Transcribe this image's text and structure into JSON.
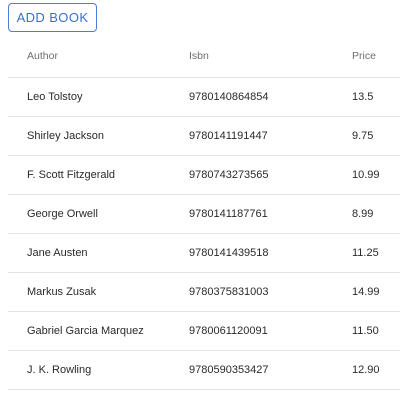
{
  "toolbar": {
    "add_label": "ADD BOOK"
  },
  "table": {
    "headers": [
      "Author",
      "Isbn",
      "Price"
    ],
    "rows": [
      {
        "author": "Leo Tolstoy",
        "isbn": "9780140864854",
        "price": "13.5"
      },
      {
        "author": "Shirley Jackson",
        "isbn": "9780141191447",
        "price": "9.75"
      },
      {
        "author": "F. Scott Fitzgerald",
        "isbn": "9780743273565",
        "price": "10.99"
      },
      {
        "author": "George Orwell",
        "isbn": "9780141187761",
        "price": "8.99"
      },
      {
        "author": "Jane Austen",
        "isbn": "9780141439518",
        "price": "11.25"
      },
      {
        "author": "Markus Zusak",
        "isbn": "9780375831003",
        "price": "14.99"
      },
      {
        "author": "Gabriel Garcia Marquez",
        "isbn": "9780061120091",
        "price": "11.50"
      },
      {
        "author": "J. K. Rowling",
        "isbn": "9780590353427",
        "price": "12.90"
      }
    ]
  },
  "colors": {
    "accent": "#3b71c9",
    "divider": "#e3e3e3",
    "header_text": "#6e6e6e"
  }
}
